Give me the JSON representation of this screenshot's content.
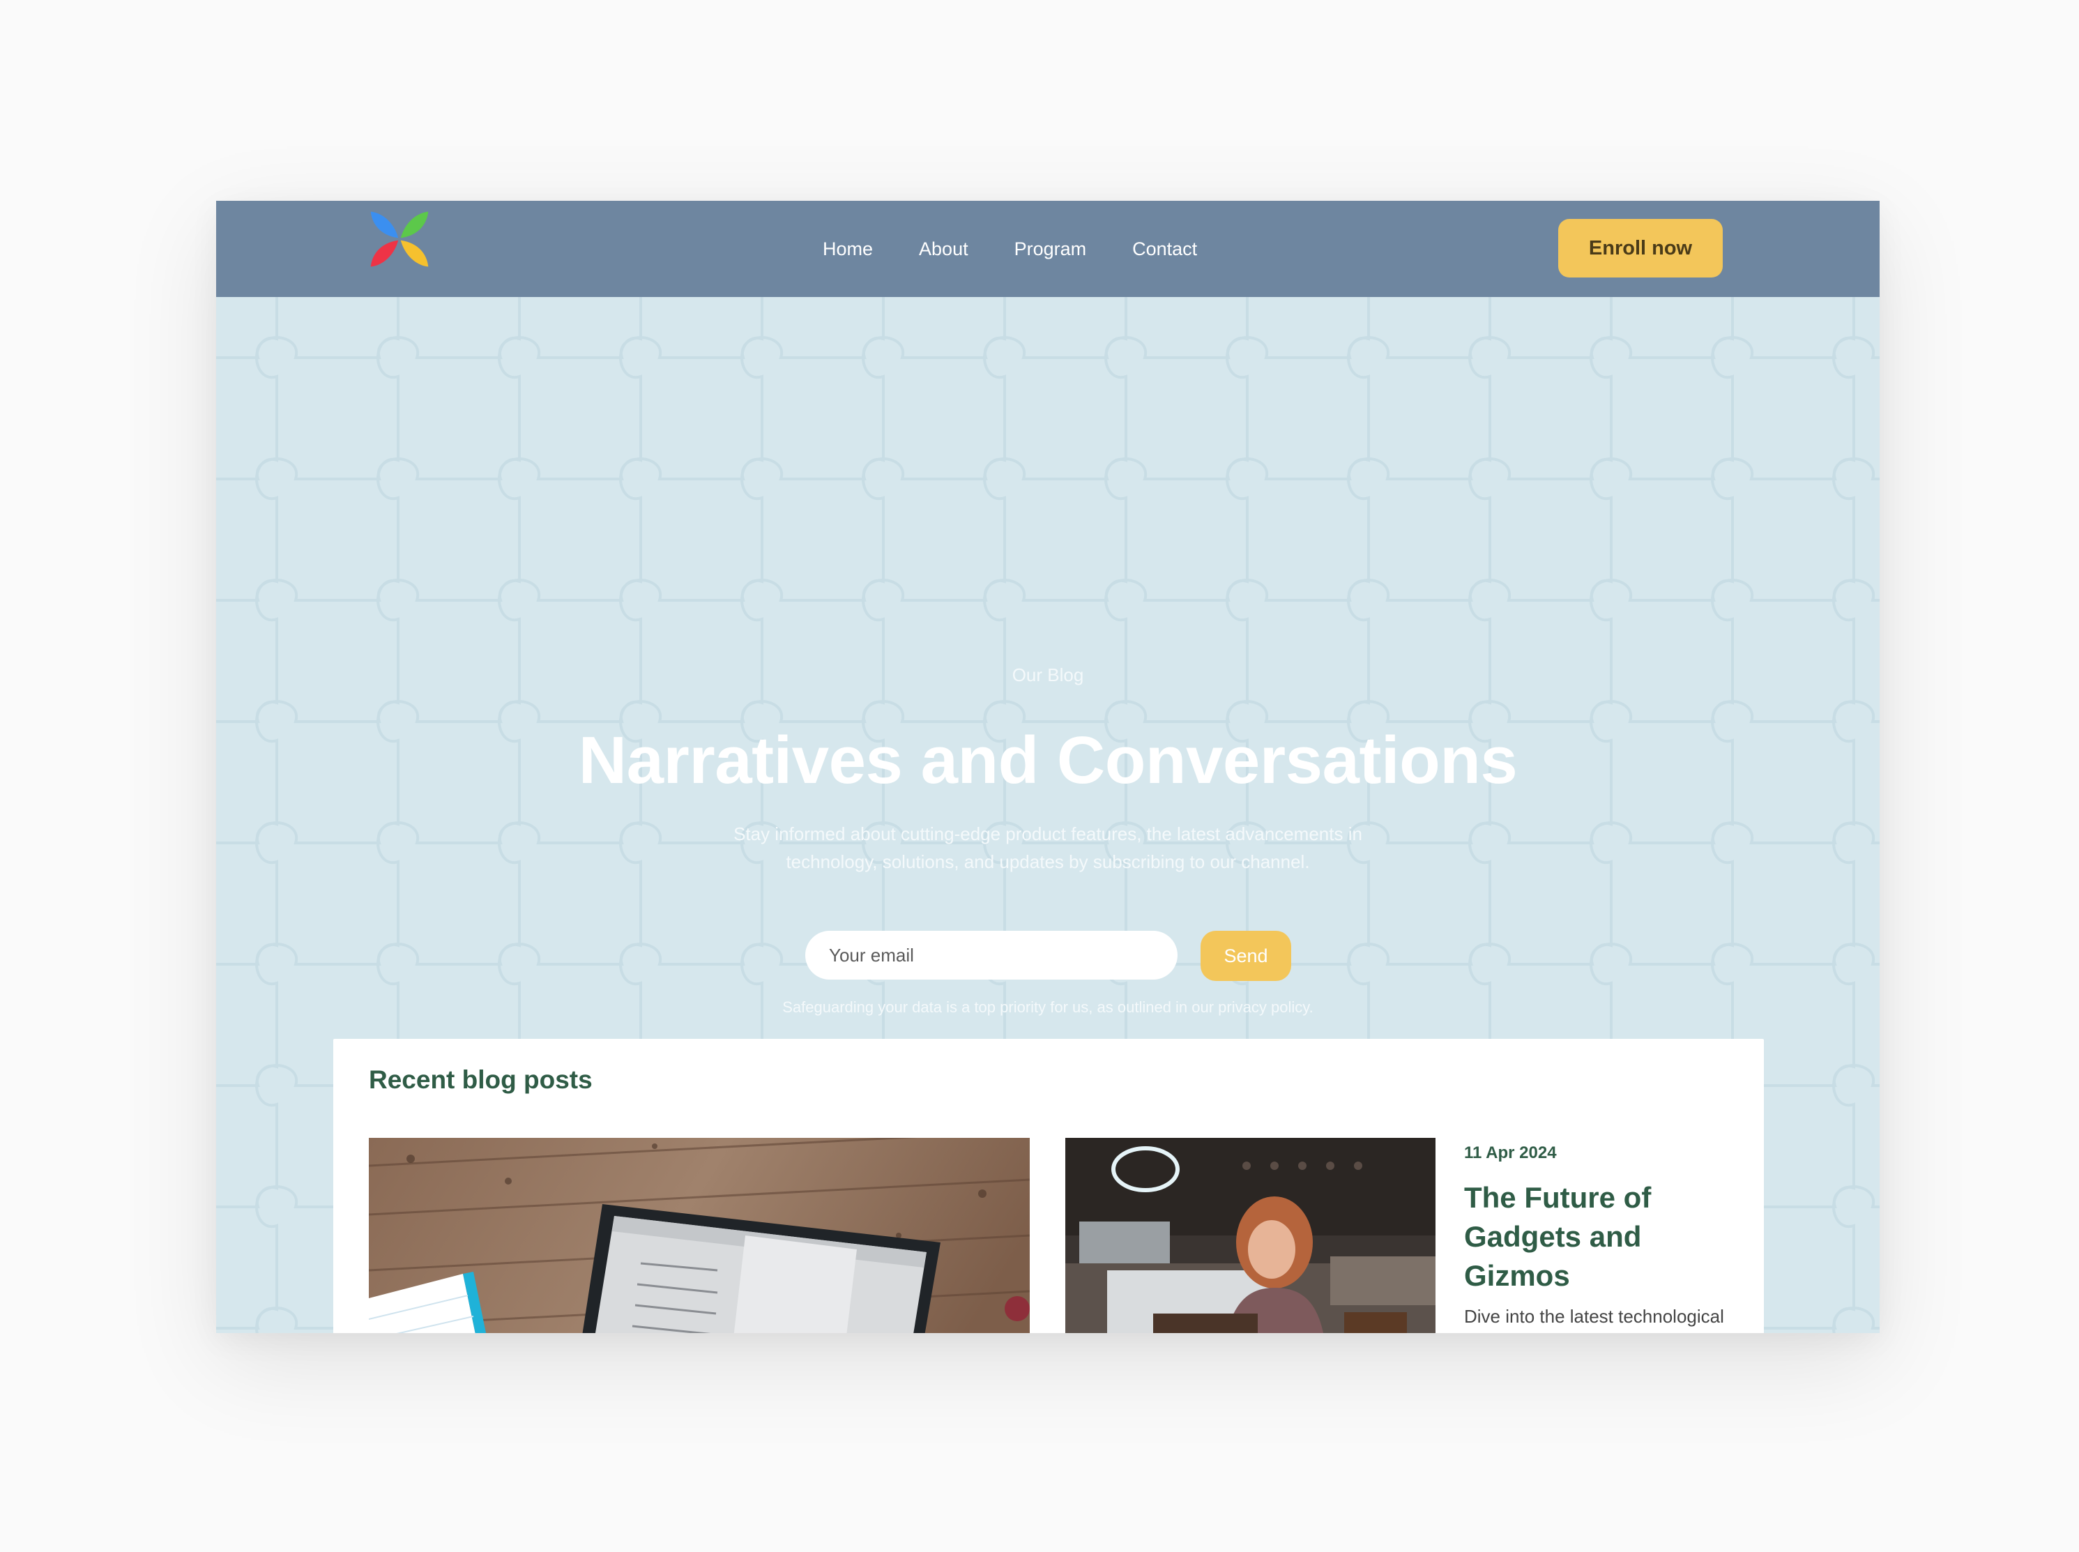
{
  "nav": {
    "links": [
      "Home",
      "About",
      "Program",
      "Contact"
    ],
    "cta_label": "Enroll now",
    "logo_icon": "four-petal-logo-icon",
    "colors": {
      "bar": "#6e86a0",
      "cta": "#f3c65a"
    }
  },
  "hero": {
    "eyebrow": "Our Blog",
    "headline": "Narratives and Conversations",
    "subtext": "Stay informed about cutting-edge product features, the latest advancements in technology, solutions, and updates by subscribing to our channel.",
    "email_placeholder": "Your email",
    "send_label": "Send",
    "privacy_note": "Safeguarding your data is a top priority for us, as outlined in our privacy policy.",
    "background": "#d6e7ed"
  },
  "blog": {
    "section_title": "Recent blog posts",
    "featured_image_icon": "laptop-on-wooden-desk-photo",
    "post": {
      "image_icon": "woman-in-cafe-photo",
      "date": "11 Apr 2024",
      "title": "The Future of Gadgets and Gizmos",
      "excerpt": "Dive into the latest technological marvels and upcoming trends that are shaping the future of gadgets and tech"
    },
    "accent": "#2f5c46"
  }
}
